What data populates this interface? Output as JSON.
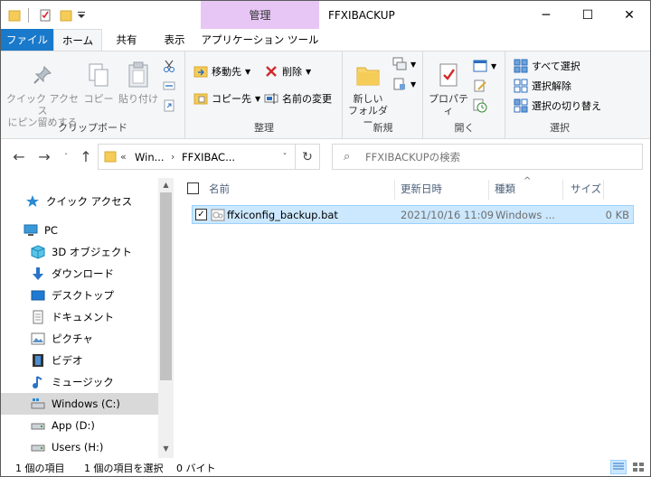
{
  "window": {
    "title": "FFXIBACKUP",
    "context_tab": "管理",
    "minimize": "─",
    "maximize": "☐",
    "close": "✕"
  },
  "ribbon_tabs": {
    "file": "ファイル",
    "home": "ホーム",
    "share": "共有",
    "view": "表示",
    "app_tools": "アプリケーション ツール",
    "collapse": "ˇ",
    "help": "?"
  },
  "ribbon": {
    "clipboard": {
      "label": "クリップボード",
      "pin_line1": "クイック アクセス",
      "pin_line2": "にピン留めする",
      "copy": "コピー",
      "paste": "貼り付け"
    },
    "organize": {
      "label": "整理",
      "move_to": "移動先",
      "copy_to": "コピー先",
      "delete": "削除",
      "rename": "名前の変更"
    },
    "new": {
      "label": "新規",
      "new_folder_line1": "新しい",
      "new_folder_line2": "フォルダー"
    },
    "open": {
      "label": "開く",
      "properties": "プロパティ"
    },
    "select": {
      "label": "選択",
      "select_all": "すべて選択",
      "select_none": "選択解除",
      "invert": "選択の切り替え"
    }
  },
  "address": {
    "overflow": "«",
    "crumb1": "Win...",
    "crumb2": "FFXIBAC..."
  },
  "search": {
    "placeholder": "FFXIBACKUPの検索"
  },
  "nav_pane": {
    "items": [
      {
        "label": "クイック アクセス"
      },
      {
        "label": "PC"
      },
      {
        "label": "3D オブジェクト"
      },
      {
        "label": "ダウンロード"
      },
      {
        "label": "デスクトップ"
      },
      {
        "label": "ドキュメント"
      },
      {
        "label": "ピクチャ"
      },
      {
        "label": "ビデオ"
      },
      {
        "label": "ミュージック"
      },
      {
        "label": "Windows (C:)"
      },
      {
        "label": "App (D:)"
      },
      {
        "label": "Users (H:)"
      }
    ]
  },
  "columns": {
    "name": "名前",
    "date": "更新日時",
    "type": "種類",
    "size": "サイズ"
  },
  "files": [
    {
      "name": "ffxiconfig_backup.bat",
      "date": "2021/10/16 11:09",
      "type": "Windows ...",
      "size": "0 KB"
    }
  ],
  "status": {
    "count": "1 個の項目",
    "selected": "1 個の項目を選択",
    "bytes": "0 バイト"
  },
  "colors": {
    "accent": "#1979ca",
    "context": "#e7c6f5",
    "selection": "#cce8ff",
    "selection_border": "#99d1ff"
  }
}
